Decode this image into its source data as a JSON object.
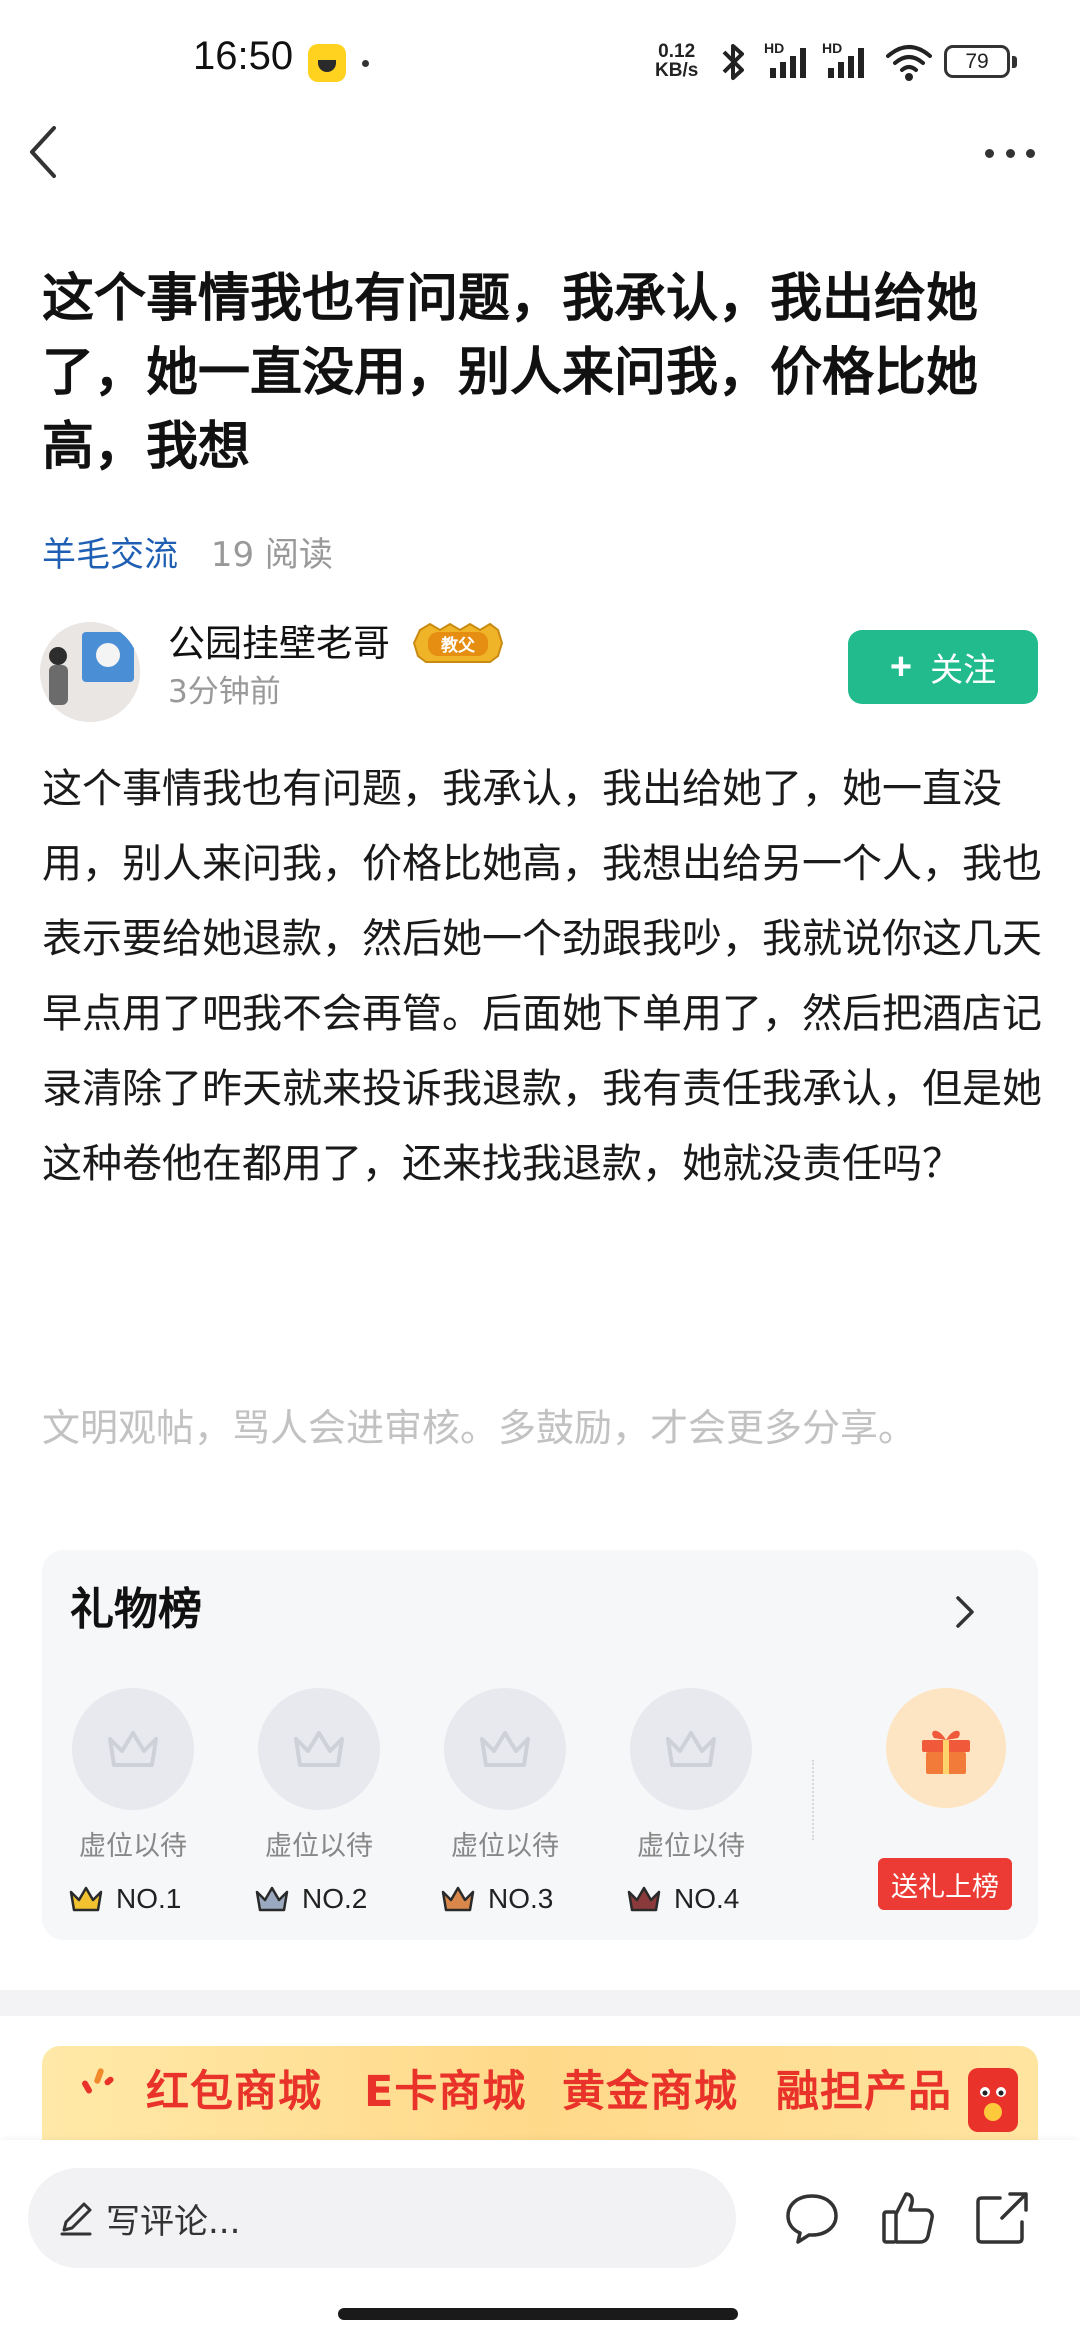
{
  "status_bar": {
    "time": "16:50",
    "net_speed_value": "0.12",
    "net_speed_unit": "KB/s",
    "battery": "79",
    "signal_1_label": "HD",
    "signal_2_label": "HD"
  },
  "post": {
    "title": "这个事情我也有问题，我承认，我出给她了，她一直没用，别人来问我，价格比她高，我想",
    "category": "羊毛交流",
    "reads": "19 阅读",
    "body": "这个事情我也有问题，我承认，我出给她了，她一直没用，别人来问我，价格比她高，我想出给另一个人，我也表示要给她退款，然后她一个劲跟我吵，我就说你这几天早点用了吧我不会再管。后面她下单用了，然后把酒店记录清除了昨天就来投诉我退款，我有责任我承认，但是她这种卷他在都用了，还来找我退款，她就没责任吗？",
    "civil_hint": "文明观帖，骂人会进审核。多鼓励，才会更多分享。"
  },
  "author": {
    "name": "公园挂壁老哥",
    "badge": "教父",
    "time": "3分钟前",
    "follow_label": "关注"
  },
  "gift_board": {
    "title": "礼物榜",
    "slots": [
      {
        "label": "虚位以待",
        "rank": "NO.1",
        "color": "#f2c230"
      },
      {
        "label": "虚位以待",
        "rank": "NO.2",
        "color": "#9aa8c0"
      },
      {
        "label": "虚位以待",
        "rank": "NO.3",
        "color": "#d9874a"
      },
      {
        "label": "虚位以待",
        "rank": "NO.4",
        "color": "#8a3a3a"
      }
    ],
    "send_label": "送礼上榜"
  },
  "banner": {
    "items": [
      "红包商城",
      "E卡商城",
      "黄金商城",
      "融担产品"
    ]
  },
  "bottom_bar": {
    "comment_placeholder": "写评论..."
  },
  "colors": {
    "accent_green": "#21bb8d",
    "link_blue": "#1e5fb4",
    "gift_red": "#ec3b34"
  }
}
